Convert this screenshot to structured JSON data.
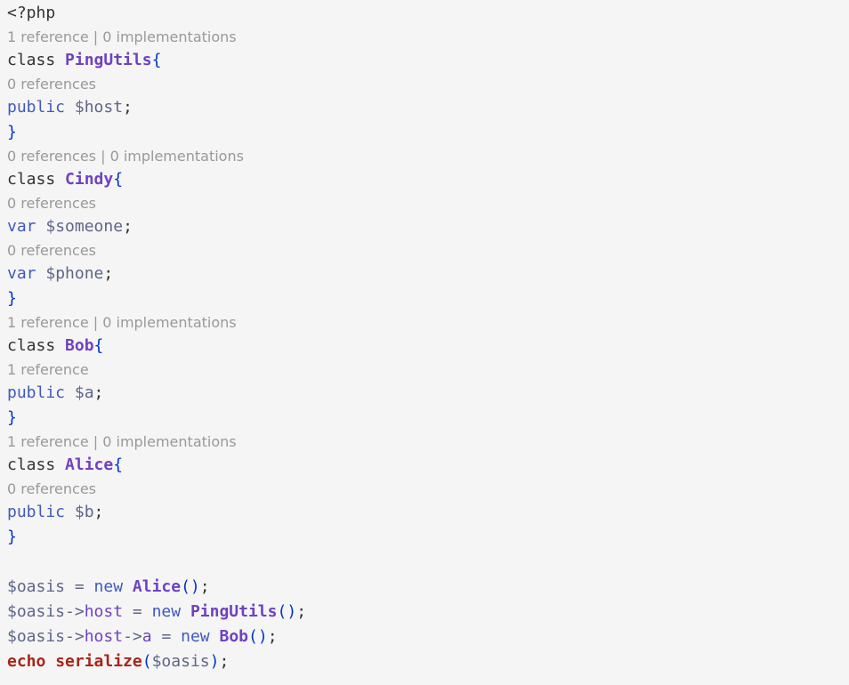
{
  "colors": {
    "background": "#f5f5f5",
    "default": "#333333",
    "keyword_class": "#333333",
    "class_name": "#6f42c1",
    "brace": "#0033cc",
    "modifier": "#4059bf",
    "property": "#6f42c1",
    "variable": "#5e6687",
    "operator": "#5e6687",
    "new_keyword": "#4059bf",
    "echo": "#a8251a",
    "function": "#a8251a",
    "codelens": "#999999"
  },
  "rows": [
    {
      "kind": "code",
      "tokens": [
        {
          "t": "<?php",
          "c": "default"
        }
      ]
    },
    {
      "kind": "lens",
      "text": "1 reference | 0 implementations"
    },
    {
      "kind": "code",
      "tokens": [
        {
          "t": "class ",
          "c": "keyword_class"
        },
        {
          "t": "PingUtils",
          "c": "class_name",
          "bold": true
        },
        {
          "t": "{",
          "c": "brace"
        }
      ]
    },
    {
      "kind": "lens",
      "text": "0 references"
    },
    {
      "kind": "code",
      "tokens": [
        {
          "t": "public ",
          "c": "modifier"
        },
        {
          "t": "$host",
          "c": "variable"
        },
        {
          "t": ";",
          "c": "default"
        }
      ]
    },
    {
      "kind": "code",
      "tokens": [
        {
          "t": "}",
          "c": "brace"
        }
      ]
    },
    {
      "kind": "lens",
      "text": "0 references | 0 implementations"
    },
    {
      "kind": "code",
      "tokens": [
        {
          "t": "class ",
          "c": "keyword_class"
        },
        {
          "t": "Cindy",
          "c": "class_name",
          "bold": true
        },
        {
          "t": "{",
          "c": "brace"
        }
      ]
    },
    {
      "kind": "lens",
      "text": "0 references"
    },
    {
      "kind": "code",
      "tokens": [
        {
          "t": "var ",
          "c": "modifier"
        },
        {
          "t": "$someone",
          "c": "variable"
        },
        {
          "t": ";",
          "c": "default"
        }
      ]
    },
    {
      "kind": "lens",
      "text": "0 references"
    },
    {
      "kind": "code",
      "tokens": [
        {
          "t": "var ",
          "c": "modifier"
        },
        {
          "t": "$phone",
          "c": "variable"
        },
        {
          "t": ";",
          "c": "default"
        }
      ]
    },
    {
      "kind": "code",
      "tokens": [
        {
          "t": "}",
          "c": "brace"
        }
      ]
    },
    {
      "kind": "lens",
      "text": "1 reference | 0 implementations"
    },
    {
      "kind": "code",
      "tokens": [
        {
          "t": "class ",
          "c": "keyword_class"
        },
        {
          "t": "Bob",
          "c": "class_name",
          "bold": true
        },
        {
          "t": "{",
          "c": "brace"
        }
      ]
    },
    {
      "kind": "lens",
      "text": "1 reference"
    },
    {
      "kind": "code",
      "tokens": [
        {
          "t": "public ",
          "c": "modifier"
        },
        {
          "t": "$a",
          "c": "variable"
        },
        {
          "t": ";",
          "c": "default"
        }
      ]
    },
    {
      "kind": "code",
      "tokens": [
        {
          "t": "}",
          "c": "brace"
        }
      ]
    },
    {
      "kind": "lens",
      "text": "1 reference | 0 implementations"
    },
    {
      "kind": "code",
      "tokens": [
        {
          "t": "class ",
          "c": "keyword_class"
        },
        {
          "t": "Alice",
          "c": "class_name",
          "bold": true
        },
        {
          "t": "{",
          "c": "brace"
        }
      ]
    },
    {
      "kind": "lens",
      "text": "0 references"
    },
    {
      "kind": "code",
      "tokens": [
        {
          "t": "public ",
          "c": "modifier"
        },
        {
          "t": "$b",
          "c": "variable"
        },
        {
          "t": ";",
          "c": "default"
        }
      ]
    },
    {
      "kind": "code",
      "tokens": [
        {
          "t": "}",
          "c": "brace"
        }
      ]
    },
    {
      "kind": "blank"
    },
    {
      "kind": "code",
      "tokens": [
        {
          "t": "$oasis",
          "c": "variable"
        },
        {
          "t": " = ",
          "c": "operator"
        },
        {
          "t": "new ",
          "c": "new_keyword"
        },
        {
          "t": "Alice",
          "c": "class_name",
          "bold": true
        },
        {
          "t": "()",
          "c": "brace"
        },
        {
          "t": ";",
          "c": "default"
        }
      ]
    },
    {
      "kind": "code",
      "tokens": [
        {
          "t": "$oasis",
          "c": "variable"
        },
        {
          "t": "->",
          "c": "operator"
        },
        {
          "t": "host",
          "c": "property"
        },
        {
          "t": " = ",
          "c": "operator"
        },
        {
          "t": "new ",
          "c": "new_keyword"
        },
        {
          "t": "PingUtils",
          "c": "class_name",
          "bold": true
        },
        {
          "t": "()",
          "c": "brace"
        },
        {
          "t": ";",
          "c": "default"
        }
      ]
    },
    {
      "kind": "code",
      "tokens": [
        {
          "t": "$oasis",
          "c": "variable"
        },
        {
          "t": "->",
          "c": "operator"
        },
        {
          "t": "host",
          "c": "property"
        },
        {
          "t": "->",
          "c": "operator"
        },
        {
          "t": "a",
          "c": "property"
        },
        {
          "t": " = ",
          "c": "operator"
        },
        {
          "t": "new ",
          "c": "new_keyword"
        },
        {
          "t": "Bob",
          "c": "class_name",
          "bold": true
        },
        {
          "t": "()",
          "c": "brace"
        },
        {
          "t": ";",
          "c": "default"
        }
      ]
    },
    {
      "kind": "code",
      "tokens": [
        {
          "t": "echo",
          "c": "echo",
          "bold": true
        },
        {
          "t": " ",
          "c": "default"
        },
        {
          "t": "serialize",
          "c": "function",
          "bold": true
        },
        {
          "t": "(",
          "c": "brace"
        },
        {
          "t": "$oasis",
          "c": "variable"
        },
        {
          "t": ")",
          "c": "brace"
        },
        {
          "t": ";",
          "c": "default"
        }
      ]
    }
  ]
}
